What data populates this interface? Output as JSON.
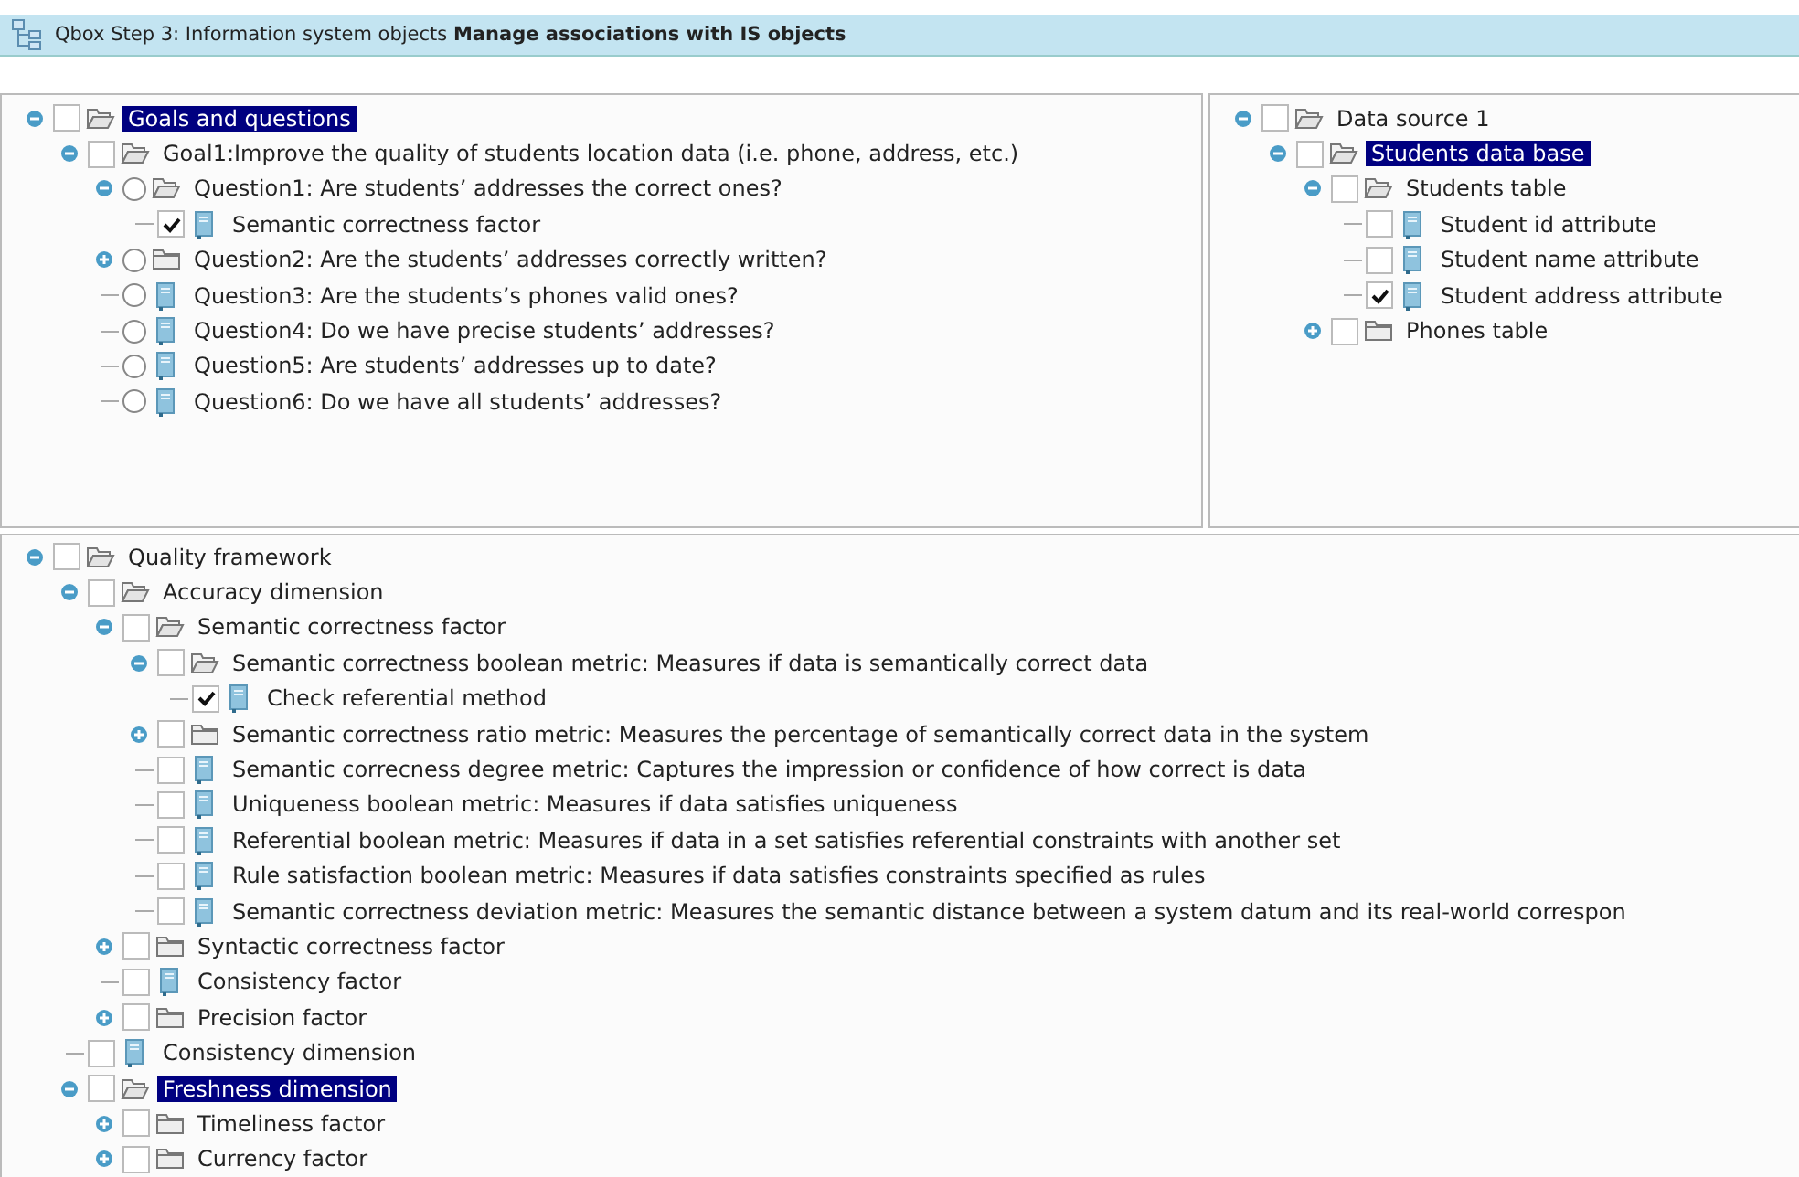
{
  "window": {
    "title": "Qbox Step 3: Information system objects **Manage associations with IS objects**"
  },
  "goals_tree": [
    {
      "label": "Goals and questions",
      "kind": "checkbox",
      "checked": false,
      "selected": true,
      "expanded": true,
      "children": [
        {
          "label": "Goal1:Improve the quality of students location data (i.e. phone, address, etc.)",
          "kind": "checkbox",
          "checked": false,
          "selected": false,
          "expanded": true,
          "children": [
            {
              "label": "Question1: Are students’ addresses the correct ones?",
              "kind": "radio",
              "checked": false,
              "selected": false,
              "expanded": true,
              "children": [
                {
                  "label": "Semantic correctness factor",
                  "kind": "checkbox",
                  "checked": true,
                  "selected": false
                }
              ]
            },
            {
              "label": "Question2: Are the students’ addresses correctly written?",
              "kind": "radio",
              "checked": false,
              "selected": false,
              "expanded": false
            },
            {
              "label": "Question3: Are the students’s phones valid ones?",
              "kind": "radio",
              "checked": false,
              "selected": false
            },
            {
              "label": "Question4: Do we have precise students’ addresses?",
              "kind": "radio",
              "checked": false,
              "selected": false
            },
            {
              "label": "Question5: Are students’ addresses up to date?",
              "kind": "radio",
              "checked": false,
              "selected": false
            },
            {
              "label": "Question6: Do we have all students’ addresses?",
              "kind": "radio",
              "checked": false,
              "selected": false
            }
          ]
        }
      ]
    }
  ],
  "data_source_tree": [
    {
      "label": "Data source 1",
      "kind": "checkbox",
      "checked": false,
      "selected": false,
      "expanded": true,
      "children": [
        {
          "label": "Students data base",
          "kind": "checkbox",
          "checked": false,
          "selected": true,
          "expanded": true,
          "children": [
            {
              "label": "Students table",
              "kind": "checkbox",
              "checked": false,
              "selected": false,
              "expanded": true,
              "children": [
                {
                  "label": "Student id attribute",
                  "kind": "checkbox",
                  "checked": false,
                  "selected": false
                },
                {
                  "label": "Student name attribute",
                  "kind": "checkbox",
                  "checked": false,
                  "selected": false
                },
                {
                  "label": "Student address attribute",
                  "kind": "checkbox",
                  "checked": true,
                  "selected": false
                }
              ]
            },
            {
              "label": "Phones table",
              "kind": "checkbox",
              "checked": false,
              "selected": false,
              "expanded": false
            }
          ]
        }
      ]
    }
  ],
  "quality_tree": [
    {
      "label": "Quality framework",
      "kind": "checkbox",
      "checked": false,
      "selected": false,
      "expanded": true,
      "children": [
        {
          "label": "Accuracy dimension",
          "kind": "checkbox",
          "checked": false,
          "selected": false,
          "expanded": true,
          "children": [
            {
              "label": "Semantic correctness factor",
              "kind": "checkbox",
              "checked": false,
              "selected": false,
              "expanded": true,
              "children": [
                {
                  "label": "Semantic correctness boolean metric: Measures if data is semantically correct data",
                  "kind": "checkbox",
                  "checked": false,
                  "selected": false,
                  "expanded": true,
                  "children": [
                    {
                      "label": "Check referential method",
                      "kind": "checkbox",
                      "checked": true,
                      "selected": false
                    }
                  ]
                },
                {
                  "label": "Semantic correctness ratio metric: Measures the percentage of semantically correct data in the system",
                  "kind": "checkbox",
                  "checked": false,
                  "selected": false,
                  "expanded": false
                },
                {
                  "label": "Semantic correcness degree metric: Captures the impression or confidence of how correct is data",
                  "kind": "checkbox",
                  "checked": false,
                  "selected": false
                },
                {
                  "label": "Uniqueness boolean metric: Measures if data satisfies uniqueness",
                  "kind": "checkbox",
                  "checked": false,
                  "selected": false
                },
                {
                  "label": "Referential boolean metric: Measures if data in a set satisfies referential constraints with another set",
                  "kind": "checkbox",
                  "checked": false,
                  "selected": false
                },
                {
                  "label": "Rule satisfaction boolean metric: Measures if data satisfies constraints specified as rules",
                  "kind": "checkbox",
                  "checked": false,
                  "selected": false
                },
                {
                  "label": "Semantic correctness deviation metric: Measures the semantic distance between a system datum and its real-world correspon",
                  "kind": "checkbox",
                  "checked": false,
                  "selected": false
                }
              ]
            },
            {
              "label": "Syntactic correctness factor",
              "kind": "checkbox",
              "checked": false,
              "selected": false,
              "expanded": false
            },
            {
              "label": "Consistency factor",
              "kind": "checkbox",
              "checked": false,
              "selected": false
            },
            {
              "label": "Precision factor",
              "kind": "checkbox",
              "checked": false,
              "selected": false,
              "expanded": false
            }
          ]
        },
        {
          "label": "Consistency dimension",
          "kind": "checkbox",
          "checked": false,
          "selected": false
        },
        {
          "label": "Freshness dimension",
          "kind": "checkbox",
          "checked": false,
          "selected": true,
          "expanded": true,
          "children": [
            {
              "label": "Timeliness factor",
              "kind": "checkbox",
              "checked": false,
              "selected": false,
              "expanded": false
            },
            {
              "label": "Currency factor",
              "kind": "checkbox",
              "checked": false,
              "selected": false,
              "expanded": false
            }
          ]
        }
      ]
    }
  ]
}
